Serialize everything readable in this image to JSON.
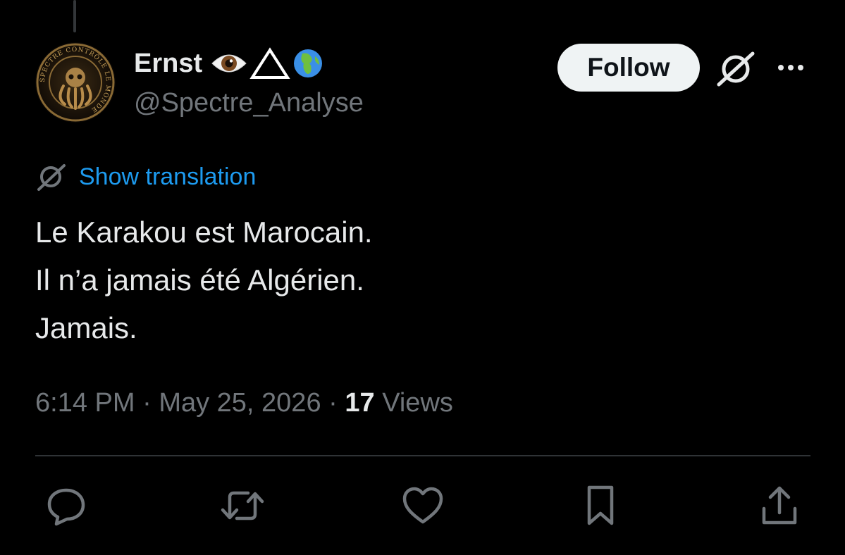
{
  "author": {
    "display_name": "Ernst",
    "name_emojis": [
      "eye",
      "triangle",
      "globe"
    ],
    "handle": "@Spectre_Analyse",
    "avatar_ring_text": "SPECTRE CONTRÔLE LE MONDE"
  },
  "header": {
    "follow_label": "Follow",
    "grok_icon": "grok-icon",
    "more_icon": "more-icon"
  },
  "translation": {
    "icon": "grok-icon",
    "label": "Show translation"
  },
  "tweet": {
    "lines": [
      "Le Karakou est Marocain.",
      "Il n’a jamais été Algérien.",
      "Jamais."
    ]
  },
  "meta": {
    "time": "6:14 PM",
    "separator": "·",
    "date": "May 25, 2026",
    "views_count": "17",
    "views_label": "Views"
  },
  "actions": [
    {
      "name": "reply",
      "icon": "reply-icon"
    },
    {
      "name": "repost",
      "icon": "repost-icon"
    },
    {
      "name": "like",
      "icon": "like-icon"
    },
    {
      "name": "bookmark",
      "icon": "bookmark-icon"
    },
    {
      "name": "share",
      "icon": "share-icon"
    }
  ],
  "colors": {
    "background": "#000000",
    "text_primary": "#e7e9ea",
    "text_secondary": "#71767b",
    "link": "#1d9bf0",
    "divider": "#2f3336",
    "follow_bg": "#eff3f4",
    "follow_text": "#0f1419"
  }
}
